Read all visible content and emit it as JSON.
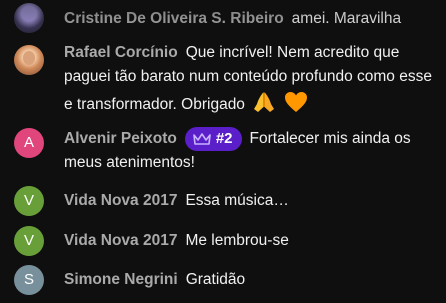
{
  "messages": [
    {
      "author": "Cristine De Oliveira S. Ribeiro",
      "text": "amei. Maravilha",
      "avatar": {
        "type": "photo",
        "letter": "",
        "color": "#3a3555"
      }
    },
    {
      "author": "Rafael Corcínio",
      "text": "Que incrível! Nem acredito que paguei tão barato num conteúdo profundo como esse e transformador. Obrigado",
      "avatar": {
        "type": "photo",
        "letter": "",
        "color": "#d08a5a"
      },
      "emojis": [
        "folded-hands-emoji",
        "orange-heart-emoji"
      ]
    },
    {
      "author": "Alvenir Peixoto",
      "badge": "#2",
      "text": "Fortalecer mis ainda os meus atenimentos!",
      "avatar": {
        "type": "letter",
        "letter": "A",
        "color": "#e0457b"
      }
    },
    {
      "author": "Vida Nova 2017",
      "text": "Essa música…",
      "avatar": {
        "type": "letter",
        "letter": "V",
        "color": "#689f38"
      }
    },
    {
      "author": "Vida Nova 2017",
      "text": "Me lembrou-se",
      "avatar": {
        "type": "letter",
        "letter": "V",
        "color": "#689f38"
      }
    },
    {
      "author": "Simone Negrini",
      "text": "Gratidão",
      "avatar": {
        "type": "letter",
        "letter": "S",
        "color": "#78909c"
      }
    }
  ],
  "colors": {
    "background": "#0f0f0f",
    "author": "#aaaaaa",
    "text": "#f1f1f1",
    "badge_bg": "#5b1fc9",
    "badge_icon": "#c7b3ff"
  },
  "icons": {
    "badge": "crown-icon"
  }
}
